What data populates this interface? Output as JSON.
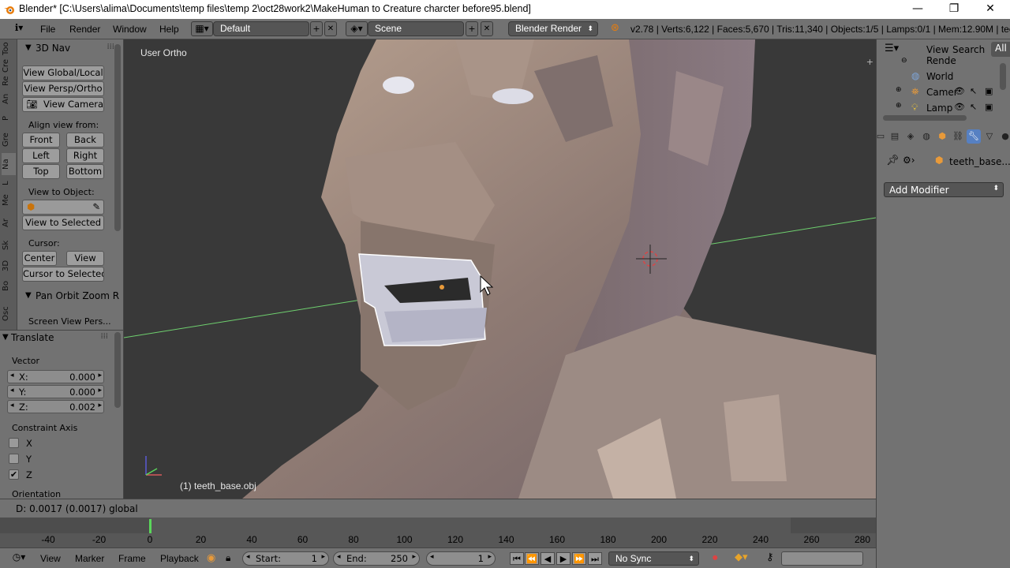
{
  "window": {
    "title": "Blender* [C:\\Users\\alima\\Documents\\temp files\\temp 2\\oct28work2\\MakeHuman to Creature charcter before95.blend]",
    "minimize": "—",
    "maximize": "❐",
    "close": "✕"
  },
  "infobar": {
    "menus": [
      "File",
      "Render",
      "Window",
      "Help"
    ],
    "layout": "Default",
    "scene": "Scene",
    "engine": "Blender Render",
    "stats": "v2.78 | Verts:6,122 | Faces:5,670 | Tris:11,340 | Objects:1/5 | Lamps:0/1 | Mem:12.90M | teeth"
  },
  "tabs": [
    "Too",
    "Cre",
    "Re",
    "An",
    "P",
    "Gre",
    "Na",
    "L",
    "Me",
    "Ar",
    "Sk",
    "3D",
    "Bo",
    "Osc"
  ],
  "toolshelf": {
    "panel_title": "3D Nav",
    "view_global_local": "View Global/Local",
    "view_persp_ortho": "View Persp/Ortho",
    "view_camera": "View Camera",
    "align_label": "Align view from:",
    "front": "Front",
    "back": "Back",
    "left": "Left",
    "right": "Right",
    "top": "Top",
    "bottom": "Bottom",
    "view_to_object_label": "View to Object:",
    "view_to_selected": "View to Selected",
    "cursor_label": "Cursor:",
    "center": "Center",
    "view": "View",
    "cursor_to_selected": "Cursor to Selected",
    "pan_panel_title": "Pan Orbit Zoom R",
    "screen_view_pers": "Screen View Pers..."
  },
  "redo": {
    "panel_title": "Translate",
    "vector_label": "Vector",
    "x_label": "X:",
    "x_value": "0.000",
    "y_label": "Y:",
    "y_value": "0.000",
    "z_label": "Z:",
    "z_value": "0.002",
    "constraint_label": "Constraint Axis",
    "cx": "X",
    "cy": "Y",
    "cz": "Z",
    "orientation_label": "Orientation"
  },
  "viewport": {
    "view_name": "User Ortho",
    "object_label": "(1) teeth_base.obj"
  },
  "statusline": "D: 0.0017 (0.0017) global",
  "timeline": {
    "ticks": [
      "-40",
      "-20",
      "0",
      "20",
      "40",
      "60",
      "80",
      "100",
      "120",
      "140",
      "160",
      "180",
      "200",
      "220",
      "240",
      "260",
      "280"
    ],
    "current_frame": 0
  },
  "bottombar": {
    "menus": [
      "View",
      "Marker",
      "Frame",
      "Playback"
    ],
    "start_label": "Start:",
    "start_value": "1",
    "end_label": "End:",
    "end_value": "250",
    "frame_value": "1",
    "sync": "No Sync"
  },
  "outliner": {
    "view": "View",
    "search": "Search",
    "filter": "All",
    "items": [
      "Rende",
      "World",
      "Camer",
      "Lamp"
    ]
  },
  "properties": {
    "object_name": "teeth_base....",
    "add_modifier": "Add Modifier"
  }
}
